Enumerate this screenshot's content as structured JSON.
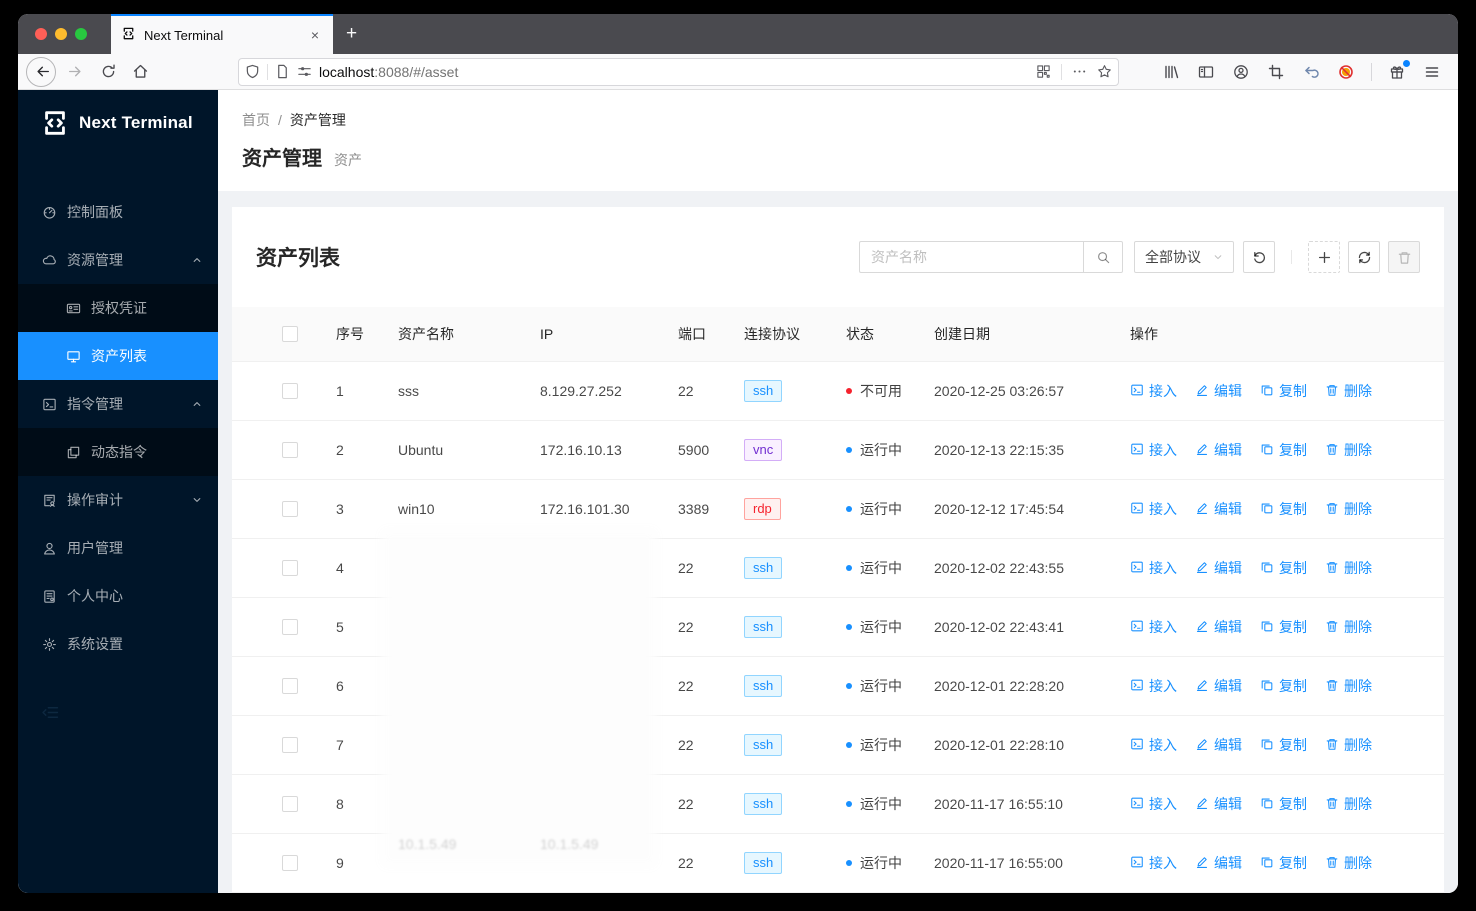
{
  "browser": {
    "tab_title": "Next Terminal",
    "url_host": "localhost",
    "url_rest": ":8088/#/asset",
    "new_tab_label": "+",
    "close_tab_label": "×"
  },
  "sidebar": {
    "brand": "Next Terminal",
    "items": [
      {
        "label": "控制面板",
        "icon": "dashboard-icon",
        "level": 1
      },
      {
        "label": "资源管理",
        "icon": "cloud-icon",
        "level": 1,
        "chevron": "up"
      },
      {
        "label": "授权凭证",
        "icon": "idcard-icon",
        "level": 2
      },
      {
        "label": "资产列表",
        "icon": "desktop-icon",
        "level": 2,
        "selected": true
      },
      {
        "label": "指令管理",
        "icon": "code-icon",
        "level": 1,
        "chevron": "up"
      },
      {
        "label": "动态指令",
        "icon": "block-icon",
        "level": 2
      },
      {
        "label": "操作审计",
        "icon": "audit-icon",
        "level": 1,
        "chevron": "down"
      },
      {
        "label": "用户管理",
        "icon": "user-icon",
        "level": 1
      },
      {
        "label": "个人中心",
        "icon": "solution-icon",
        "level": 1
      },
      {
        "label": "系统设置",
        "icon": "setting-icon",
        "level": 1
      }
    ]
  },
  "breadcrumb": {
    "home": "首页",
    "separator": "/",
    "current": "资产管理"
  },
  "page": {
    "title": "资产管理",
    "subtitle": "资产"
  },
  "card": {
    "title": "资产列表"
  },
  "toolbar": {
    "search_placeholder": "资产名称",
    "protocol_filter": "全部协议"
  },
  "table": {
    "headers": [
      "序号",
      "资产名称",
      "IP",
      "端口",
      "连接协议",
      "状态",
      "创建日期",
      "操作"
    ],
    "actions": {
      "access": "接入",
      "edit": "编辑",
      "copy": "复制",
      "delete": "删除"
    },
    "rows": [
      {
        "no": "1",
        "name": "sss",
        "ip": "8.129.27.252",
        "port": "22",
        "protocol": "ssh",
        "status": "不可用",
        "status_color": "#f5222d",
        "created": "2020-12-25 03:26:57"
      },
      {
        "no": "2",
        "name": "Ubuntu",
        "ip": "172.16.10.13",
        "port": "5900",
        "protocol": "vnc",
        "status": "运行中",
        "status_color": "#1890ff",
        "created": "2020-12-13 22:15:35"
      },
      {
        "no": "3",
        "name": "win10",
        "ip": "172.16.101.30",
        "port": "3389",
        "protocol": "rdp",
        "status": "运行中",
        "status_color": "#1890ff",
        "created": "2020-12-12 17:45:54"
      },
      {
        "no": "4",
        "name": "",
        "ip": "",
        "port": "22",
        "protocol": "ssh",
        "status": "运行中",
        "status_color": "#1890ff",
        "created": "2020-12-02 22:43:55",
        "censored": true
      },
      {
        "no": "5",
        "name": "",
        "ip": "",
        "port": "22",
        "protocol": "ssh",
        "status": "运行中",
        "status_color": "#1890ff",
        "created": "2020-12-02 22:43:41",
        "censored": true
      },
      {
        "no": "6",
        "name": "",
        "ip": "",
        "port": "22",
        "protocol": "ssh",
        "status": "运行中",
        "status_color": "#1890ff",
        "created": "2020-12-01 22:28:20",
        "censored": true
      },
      {
        "no": "7",
        "name": "",
        "ip": "",
        "port": "22",
        "protocol": "ssh",
        "status": "运行中",
        "status_color": "#1890ff",
        "created": "2020-12-01 22:28:10",
        "censored": true
      },
      {
        "no": "8",
        "name": "",
        "ip": "",
        "port": "22",
        "protocol": "ssh",
        "status": "运行中",
        "status_color": "#1890ff",
        "created": "2020-11-17 16:55:10",
        "censored": true
      },
      {
        "no": "9",
        "name": "10.1.5.49",
        "ip": "10.1.5.49",
        "port": "22",
        "protocol": "ssh",
        "status": "运行中",
        "status_color": "#1890ff",
        "created": "2020-11-17 16:55:00",
        "censored": true
      }
    ]
  },
  "colors": {
    "accent": "#1890ff",
    "sidebar_bg": "#001529",
    "submenu_bg": "#000c17",
    "selected_bg": "#1890ff",
    "status_running": "#1890ff",
    "status_unavailable": "#f5222d",
    "tag_ssh": "#1890ff",
    "tag_vnc": "#722ed1",
    "tag_rdp": "#f5222d",
    "tab_accent": "#0a84ff"
  }
}
